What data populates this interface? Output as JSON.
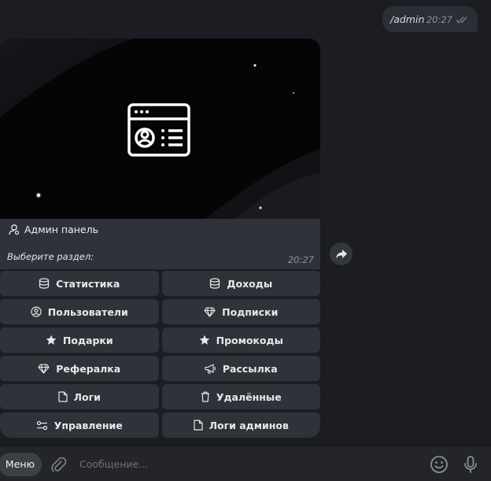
{
  "outgoing": {
    "text": "/admin",
    "time": "20:27"
  },
  "message": {
    "title": "Админ панель",
    "subtitle": "Выберите раздел:",
    "time": "20:27"
  },
  "keyboard": [
    [
      {
        "label": "Статистика",
        "icon": "database-icon"
      },
      {
        "label": "Доходы",
        "icon": "database-icon"
      }
    ],
    [
      {
        "label": "Пользователи",
        "icon": "user-circle-icon"
      },
      {
        "label": "Подписки",
        "icon": "diamond-icon"
      }
    ],
    [
      {
        "label": "Подарки",
        "icon": "star-icon"
      },
      {
        "label": "Промокоды",
        "icon": "star-icon"
      }
    ],
    [
      {
        "label": "Рефералка",
        "icon": "diamond-icon"
      },
      {
        "label": "Рассылка",
        "icon": "megaphone-icon"
      }
    ],
    [
      {
        "label": "Логи",
        "icon": "file-icon"
      },
      {
        "label": "Удалённые",
        "icon": "trash-icon"
      }
    ],
    [
      {
        "label": "Управление",
        "icon": "sliders-icon"
      },
      {
        "label": "Логи админов",
        "icon": "file-icon"
      }
    ]
  ],
  "composer": {
    "menu_label": "Меню",
    "placeholder": "Сообщение..."
  }
}
